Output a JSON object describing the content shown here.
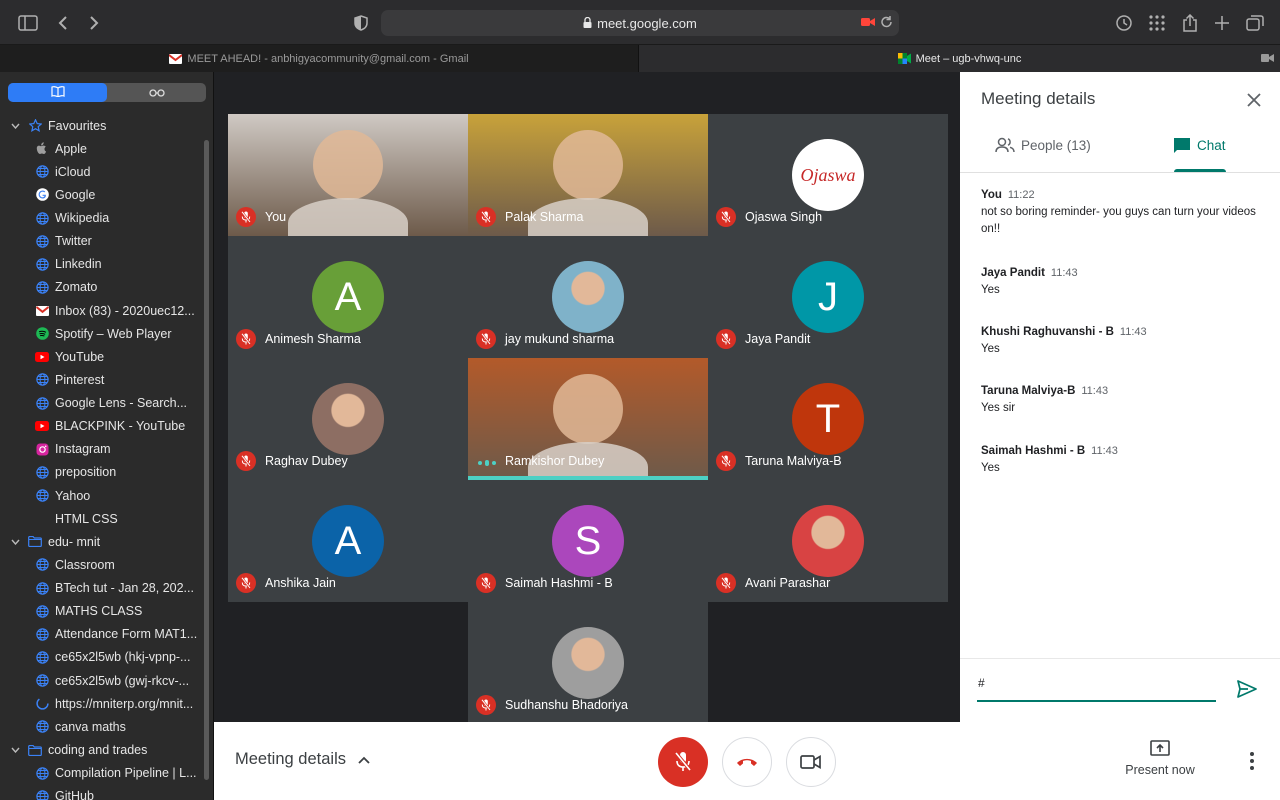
{
  "browser": {
    "url": "meet.google.com",
    "tabs": [
      {
        "label": "MEET AHEAD! - anbhigyacommunity@gmail.com - Gmail"
      },
      {
        "label": "Meet – ugb-vhwq-unc"
      }
    ]
  },
  "sidebar": {
    "items": [
      {
        "label": "Favourites",
        "icon": "star-icon",
        "level": 0
      },
      {
        "label": "Apple",
        "icon": "apple-icon",
        "level": 1
      },
      {
        "label": "iCloud",
        "icon": "globe-icon",
        "level": 1
      },
      {
        "label": "Google",
        "icon": "google-icon",
        "level": 1
      },
      {
        "label": "Wikipedia",
        "icon": "globe-icon",
        "level": 1
      },
      {
        "label": "Twitter",
        "icon": "globe-icon",
        "level": 1
      },
      {
        "label": "Linkedin",
        "icon": "globe-icon",
        "level": 1
      },
      {
        "label": "Zomato",
        "icon": "globe-icon",
        "level": 1
      },
      {
        "label": "Inbox (83) - 2020uec12...",
        "icon": "gmail-icon",
        "level": 1
      },
      {
        "label": "Spotify – Web Player",
        "icon": "spotify-icon",
        "level": 1
      },
      {
        "label": "YouTube",
        "icon": "youtube-icon",
        "level": 1
      },
      {
        "label": "Pinterest",
        "icon": "globe-icon",
        "level": 1
      },
      {
        "label": "Google Lens - Search...",
        "icon": "globe-icon",
        "level": 1
      },
      {
        "label": "BLACKPINK - YouTube",
        "icon": "youtube-icon",
        "level": 1
      },
      {
        "label": "Instagram",
        "icon": "instagram-icon",
        "level": 1
      },
      {
        "label": "preposition",
        "icon": "globe-icon",
        "level": 1
      },
      {
        "label": "Yahoo",
        "icon": "globe-icon",
        "level": 1
      },
      {
        "label": "HTML CSS",
        "icon": "none",
        "level": 1
      },
      {
        "label": "edu- mnit",
        "icon": "folder-icon",
        "level": 0
      },
      {
        "label": "Classroom",
        "icon": "globe-icon",
        "level": 1
      },
      {
        "label": "BTech tut - Jan 28, 202...",
        "icon": "globe-icon",
        "level": 1
      },
      {
        "label": "MATHS CLASS",
        "icon": "globe-icon",
        "level": 1
      },
      {
        "label": "Attendance Form MAT1...",
        "icon": "globe-icon",
        "level": 1
      },
      {
        "label": "ce65x2l5wb (hkj-vpnp-...",
        "icon": "globe-icon",
        "level": 1
      },
      {
        "label": "ce65x2l5wb (gwj-rkcv-...",
        "icon": "globe-icon",
        "level": 1
      },
      {
        "label": "https://mniterp.org/mnit...",
        "icon": "loading-icon",
        "level": 1
      },
      {
        "label": "canva maths",
        "icon": "globe-icon",
        "level": 1
      },
      {
        "label": "coding and trades",
        "icon": "folder-icon",
        "level": 0
      },
      {
        "label": "Compilation Pipeline | L...",
        "icon": "globe-icon",
        "level": 1
      },
      {
        "label": "GitHub",
        "icon": "globe-icon",
        "level": 1
      }
    ]
  },
  "participants": [
    {
      "name": "You",
      "type": "video",
      "color": "#cfc9c4"
    },
    {
      "name": "Palak Sharma",
      "type": "video",
      "color": "#c8a23a"
    },
    {
      "name": "Ojaswa Singh",
      "type": "logo",
      "initial": "Ojaswa",
      "color": "#ffffff"
    },
    {
      "name": "Animesh Sharma",
      "type": "initial",
      "initial": "A",
      "color": "#689f38"
    },
    {
      "name": "jay mukund sharma",
      "type": "photo",
      "color": "#7fb2c9"
    },
    {
      "name": "Jaya Pandit",
      "type": "initial",
      "initial": "J",
      "color": "#0097a7"
    },
    {
      "name": "Raghav Dubey",
      "type": "photo",
      "color": "#8d6e63"
    },
    {
      "name": "Ramkishor Dubey",
      "type": "video",
      "color": "#b35a2a",
      "speaking": true
    },
    {
      "name": "Taruna Malviya-B",
      "type": "initial",
      "initial": "T",
      "color": "#bf360c"
    },
    {
      "name": "Anshika Jain",
      "type": "initial",
      "initial": "A",
      "color": "#0b63a8"
    },
    {
      "name": "Saimah Hashmi - B",
      "type": "initial",
      "initial": "S",
      "color": "#ab47bc"
    },
    {
      "name": "Avani Parashar",
      "type": "photo",
      "color": "#d84343"
    },
    {
      "name": "Sudhanshu Bhadoriya",
      "type": "photo",
      "color": "#9e9e9e"
    }
  ],
  "panel": {
    "title": "Meeting details",
    "people_tab": "People (13)",
    "chat_tab": "Chat",
    "messages": [
      {
        "sender": "You",
        "time": "11:22",
        "text": "not so boring reminder- you guys can turn your videos on!!"
      },
      {
        "sender": "Jaya Pandit",
        "time": "11:43",
        "text": "Yes"
      },
      {
        "sender": "Khushi Raghuvanshi - B",
        "time": "11:43",
        "text": "Yes"
      },
      {
        "sender": "Taruna Malviya-B",
        "time": "11:43",
        "text": "Yes sir"
      },
      {
        "sender": "Saimah Hashmi - B",
        "time": "11:43",
        "text": "Yes"
      }
    ],
    "input_value": "#"
  },
  "bottom": {
    "meeting_details_label": "Meeting details",
    "present_label": "Present now"
  },
  "colors": {
    "accent": "#00796b",
    "danger": "#d93025",
    "speaking": "#4dd0c4"
  }
}
